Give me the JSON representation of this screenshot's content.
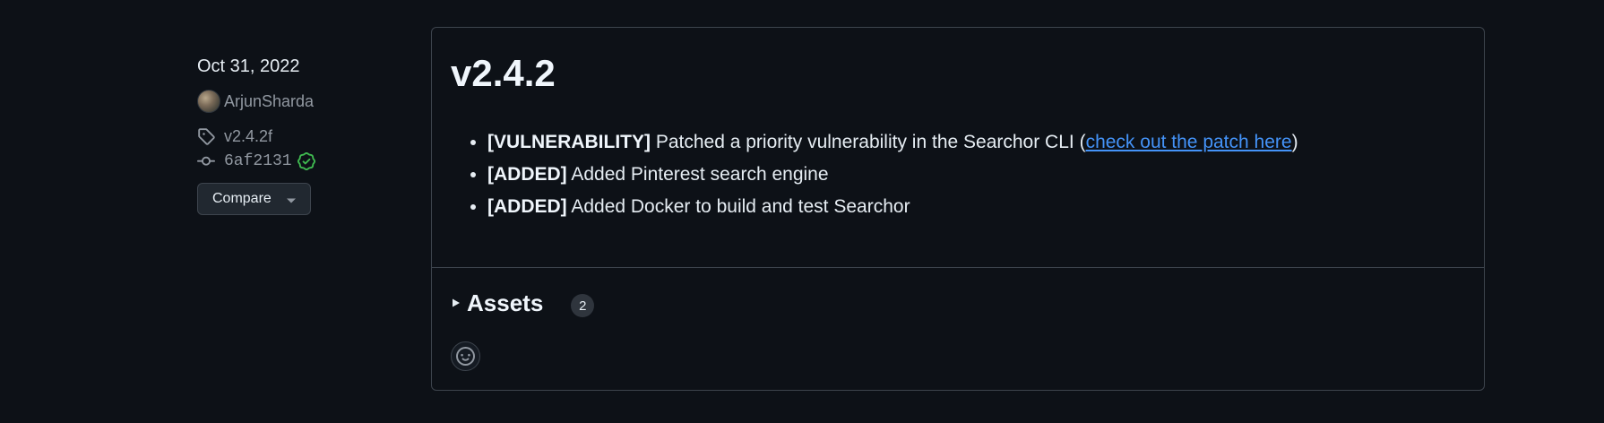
{
  "sidebar": {
    "date": "Oct 31, 2022",
    "author": "ArjunSharda",
    "tag": "v2.4.2f",
    "commit": "6af2131",
    "compare_label": "Compare"
  },
  "release": {
    "title": "v2.4.2",
    "notes": [
      {
        "tag": "[VULNERABILITY]",
        "text": " Patched a priority vulnerability in the Searchor CLI (",
        "link": "check out the patch here",
        "after": ")"
      },
      {
        "tag": "[ADDED]",
        "text": " Added Pinterest search engine"
      },
      {
        "tag": "[ADDED]",
        "text": " Added Docker to build and test Searchor"
      }
    ]
  },
  "assets": {
    "title": "Assets",
    "count": "2"
  },
  "colors": {
    "background": "#0d1117",
    "link": "#4493f8",
    "verified": "#3fb950",
    "border": "#3d444d"
  },
  "icons": {
    "tag": "tag-icon",
    "commit": "git-commit-icon",
    "verified": "verified-check-icon",
    "caret": "triangle-down-icon",
    "expand": "triangle-right-icon",
    "reaction": "smiley-icon"
  }
}
